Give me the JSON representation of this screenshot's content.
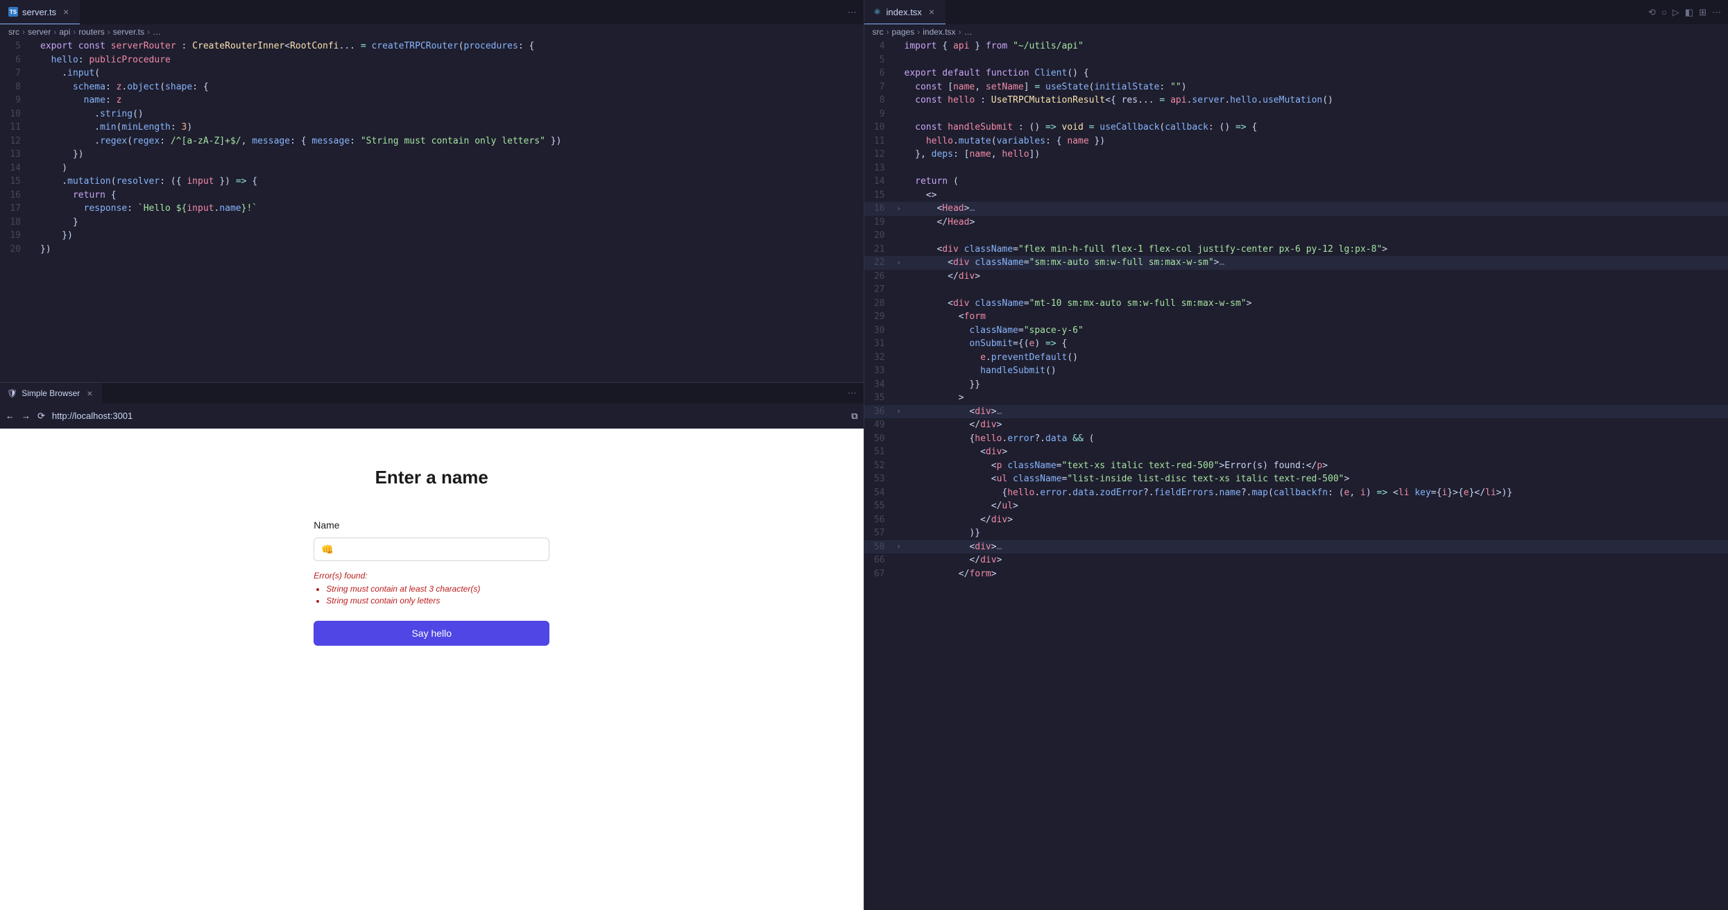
{
  "leftEditor": {
    "tab": {
      "icon": "TS",
      "name": "server.ts"
    },
    "breadcrumb": [
      "src",
      "server",
      "api",
      "routers",
      "server.ts",
      "…"
    ],
    "lines": [
      {
        "n": 5,
        "html": "<span class='kw'>export</span> <span class='kw'>const</span> <span class='var'>serverRouter</span> : <span class='type'>CreateRouterInner</span>&lt;<span class='type'>RootConfi</span>... <span class='op'>=</span> <span class='fn'>createTRPCRouter</span>(<span class='prop'>procedures</span>: {"
      },
      {
        "n": 6,
        "html": "  <span class='prop'>hello</span>: <span class='var'>publicProcedure</span>"
      },
      {
        "n": 7,
        "html": "    .<span class='fn'>input</span>("
      },
      {
        "n": 8,
        "html": "      <span class='prop'>schema</span>: <span class='var'>z</span>.<span class='fn'>object</span>(<span class='prop'>shape</span>: {"
      },
      {
        "n": 9,
        "html": "        <span class='prop'>name</span>: <span class='var'>z</span>"
      },
      {
        "n": 10,
        "html": "          .<span class='fn'>string</span>()"
      },
      {
        "n": 11,
        "html": "          .<span class='fn'>min</span>(<span class='prop'>minLength</span>: <span class='num'>3</span>)"
      },
      {
        "n": 12,
        "html": "          .<span class='fn'>regex</span>(<span class='prop'>regex</span>: <span class='str'>/^[a-zA-Z]+$/</span>, <span class='prop'>message</span>: { <span class='prop'>message</span>: <span class='str'>\"String must contain only letters\"</span> })"
      },
      {
        "n": 13,
        "html": "      })"
      },
      {
        "n": 14,
        "html": "    )"
      },
      {
        "n": 15,
        "html": "    .<span class='fn'>mutation</span>(<span class='prop'>resolver</span>: ({ <span class='var'>input</span> }) <span class='op'>=&gt;</span> {"
      },
      {
        "n": 16,
        "html": "      <span class='kw'>return</span> {"
      },
      {
        "n": 17,
        "html": "        <span class='prop'>response</span>: <span class='str'>`Hello ${</span><span class='var'>input</span>.<span class='prop'>name</span><span class='str'>}!`</span>"
      },
      {
        "n": 18,
        "html": "      }"
      },
      {
        "n": 19,
        "html": "    })"
      },
      {
        "n": 20,
        "html": "})"
      }
    ]
  },
  "browser": {
    "tabName": "Simple Browser",
    "url": "http://localhost:3001",
    "page": {
      "title": "Enter a name",
      "nameLabel": "Name",
      "nameValue": "👊",
      "errorsHeading": "Error(s) found:",
      "errors": [
        "String must contain at least 3 character(s)",
        "String must contain only letters"
      ],
      "submitLabel": "Say hello"
    }
  },
  "rightEditor": {
    "tab": {
      "name": "index.tsx"
    },
    "breadcrumb": [
      "src",
      "pages",
      "index.tsx",
      "…"
    ],
    "lines": [
      {
        "n": 4,
        "html": "<span class='kw'>import</span> { <span class='var'>api</span> } <span class='kw'>from</span> <span class='str'>\"~/utils/api\"</span>"
      },
      {
        "n": 5,
        "html": ""
      },
      {
        "n": 6,
        "html": "<span class='kw'>export</span> <span class='kw'>default</span> <span class='kw'>function</span> <span class='fn'>Client</span>() {"
      },
      {
        "n": 7,
        "html": "  <span class='kw'>const</span> [<span class='var'>name</span>, <span class='var'>setName</span>] <span class='op'>=</span> <span class='fn'>useState</span>(<span class='prop'>initialState</span>: <span class='str'>\"\"</span>)"
      },
      {
        "n": 8,
        "html": "  <span class='kw'>const</span> <span class='var'>hello</span> : <span class='type'>UseTRPCMutationResult</span>&lt;{ res... <span class='op'>=</span> <span class='var'>api</span>.<span class='prop'>server</span>.<span class='prop'>hello</span>.<span class='fn'>useMutation</span>()"
      },
      {
        "n": 9,
        "html": ""
      },
      {
        "n": 10,
        "html": "  <span class='kw'>const</span> <span class='var'>handleSubmit</span> : () <span class='op'>=&gt;</span> <span class='type'>void</span> <span class='op'>=</span> <span class='fn'>useCallback</span>(<span class='prop'>callback</span>: () <span class='op'>=&gt;</span> {"
      },
      {
        "n": 11,
        "html": "    <span class='var'>hello</span>.<span class='fn'>mutate</span>(<span class='prop'>variables</span>: { <span class='var'>name</span> })"
      },
      {
        "n": 12,
        "html": "  }, <span class='prop'>deps</span>: [<span class='var'>name</span>, <span class='var'>hello</span>])"
      },
      {
        "n": 13,
        "html": ""
      },
      {
        "n": 14,
        "html": "  <span class='kw'>return</span> ("
      },
      {
        "n": 15,
        "html": "    &lt;&gt;"
      },
      {
        "n": 16,
        "fold": true,
        "hl": true,
        "html": "      &lt;<span class='tag'>Head</span>&gt;<span class='fold-dots'>…</span>"
      },
      {
        "n": 19,
        "html": "      &lt;/<span class='tag'>Head</span>&gt;"
      },
      {
        "n": 20,
        "html": ""
      },
      {
        "n": 21,
        "html": "      &lt;<span class='tag'>div</span> <span class='attr'>className</span>=<span class='str'>\"flex min-h-full flex-1 flex-col justify-center px-6 py-12 lg:px-8\"</span>&gt;"
      },
      {
        "n": 22,
        "fold": true,
        "hl": true,
        "html": "        &lt;<span class='tag'>div</span> <span class='attr'>className</span>=<span class='str'>\"sm:mx-auto sm:w-full sm:max-w-sm\"</span>&gt;<span class='fold-dots'>…</span>"
      },
      {
        "n": 26,
        "html": "        &lt;/<span class='tag'>div</span>&gt;"
      },
      {
        "n": 27,
        "html": ""
      },
      {
        "n": 28,
        "html": "        &lt;<span class='tag'>div</span> <span class='attr'>className</span>=<span class='str'>\"mt-10 sm:mx-auto sm:w-full sm:max-w-sm\"</span>&gt;"
      },
      {
        "n": 29,
        "html": "          &lt;<span class='tag'>form</span>"
      },
      {
        "n": 30,
        "html": "            <span class='attr'>className</span>=<span class='str'>\"space-y-6\"</span>"
      },
      {
        "n": 31,
        "html": "            <span class='attr'>onSubmit</span>={(<span class='var'>e</span>) <span class='op'>=&gt;</span> {"
      },
      {
        "n": 32,
        "html": "              <span class='var'>e</span>.<span class='fn'>preventDefault</span>()"
      },
      {
        "n": 33,
        "html": "              <span class='fn'>handleSubmit</span>()"
      },
      {
        "n": 34,
        "html": "            }}"
      },
      {
        "n": 35,
        "html": "          &gt;"
      },
      {
        "n": 36,
        "fold": true,
        "hl": true,
        "html": "            &lt;<span class='tag'>div</span>&gt;<span class='fold-dots'>…</span>"
      },
      {
        "n": 49,
        "html": "            &lt;/<span class='tag'>div</span>&gt;"
      },
      {
        "n": 50,
        "html": "            {<span class='var'>hello</span>.<span class='prop'>error</span>?.<span class='prop'>data</span> <span class='op'>&amp;&amp;</span> ("
      },
      {
        "n": 51,
        "html": "              &lt;<span class='tag'>div</span>&gt;"
      },
      {
        "n": 52,
        "html": "                &lt;<span class='tag'>p</span> <span class='attr'>className</span>=<span class='str'>\"text-xs italic text-red-500\"</span>&gt;Error(s) found:&lt;/<span class='tag'>p</span>&gt;"
      },
      {
        "n": 53,
        "html": "                &lt;<span class='tag'>ul</span> <span class='attr'>className</span>=<span class='str'>\"list-inside list-disc text-xs italic text-red-500\"</span>&gt;"
      },
      {
        "n": 54,
        "html": "                  {<span class='var'>hello</span>.<span class='prop'>error</span>.<span class='prop'>data</span>.<span class='prop'>zodError</span>?.<span class='prop'>fieldErrors</span>.<span class='prop'>name</span>?.<span class='fn'>map</span>(<span class='prop'>callbackfn</span>: (<span class='var'>e</span>, <span class='var'>i</span>) <span class='op'>=&gt;</span> &lt;<span class='tag'>li</span> <span class='attr'>key</span>={<span class='var'>i</span>}&gt;{<span class='var'>e</span>}&lt;/<span class='tag'>li</span>&gt;)}"
      },
      {
        "n": 55,
        "html": "                &lt;/<span class='tag'>ul</span>&gt;"
      },
      {
        "n": 56,
        "html": "              &lt;/<span class='tag'>div</span>&gt;"
      },
      {
        "n": 57,
        "html": "            )}"
      },
      {
        "n": 58,
        "fold": true,
        "hl": true,
        "html": "            &lt;<span class='tag'>div</span>&gt;<span class='fold-dots'>…</span>"
      },
      {
        "n": 66,
        "html": "            &lt;/<span class='tag'>div</span>&gt;"
      },
      {
        "n": 67,
        "html": "          &lt;/<span class='tag'>form</span>&gt;"
      }
    ]
  }
}
